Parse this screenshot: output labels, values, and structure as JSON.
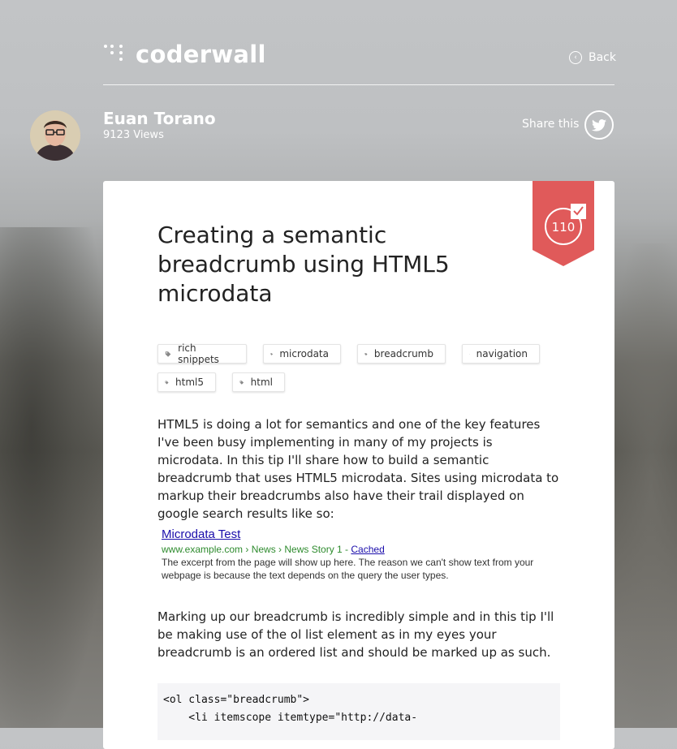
{
  "brand": {
    "name": "coderwall"
  },
  "nav": {
    "back_label": "Back"
  },
  "author": {
    "name": "Euan Torano",
    "views": "9123 Views"
  },
  "share": {
    "label": "Share this"
  },
  "badge": {
    "count": "110"
  },
  "article": {
    "title": "Creating a semantic breadcrumb using HTML5 microdata",
    "tags": [
      "rich snippets",
      "microdata",
      "breadcrumb",
      "navigation",
      "html5",
      "html"
    ],
    "paragraph1": "HTML5 is doing a lot for semantics and one of the key features I've been busy implementing in many of my projects is microdata. In this tip I'll share how to build a semantic breadcrumb that uses HTML5 microdata. Sites using microdata to markup their breadcrumbs also have their trail displayed on google search results like so:",
    "search_result": {
      "title": "Microdata Test",
      "url": "www.example.com › News › News Story 1 - ",
      "cached": "Cached",
      "snippet": "The excerpt from the page will show up here. The reason we can't show text from your webpage is because the text depends on the query the user types."
    },
    "paragraph2": "Marking up our breadcrumb is incredibly simple and in this tip I'll be making use of the ol list element as in my eyes your breadcrumb is an ordered list and should be marked up as such.",
    "code_lines": [
      "<ol class=\"breadcrumb\">",
      "    <li itemscope itemtype=\"http://data-"
    ]
  },
  "colors": {
    "ribbon": "#e05a5a",
    "link": "#1a0dab",
    "url_green": "#2e8b2e"
  },
  "icons": {
    "back": "chevron-left-circle-icon",
    "share": "twitter-bird-icon",
    "tag": "tag-icon",
    "badge": "upvote-check-icon"
  }
}
